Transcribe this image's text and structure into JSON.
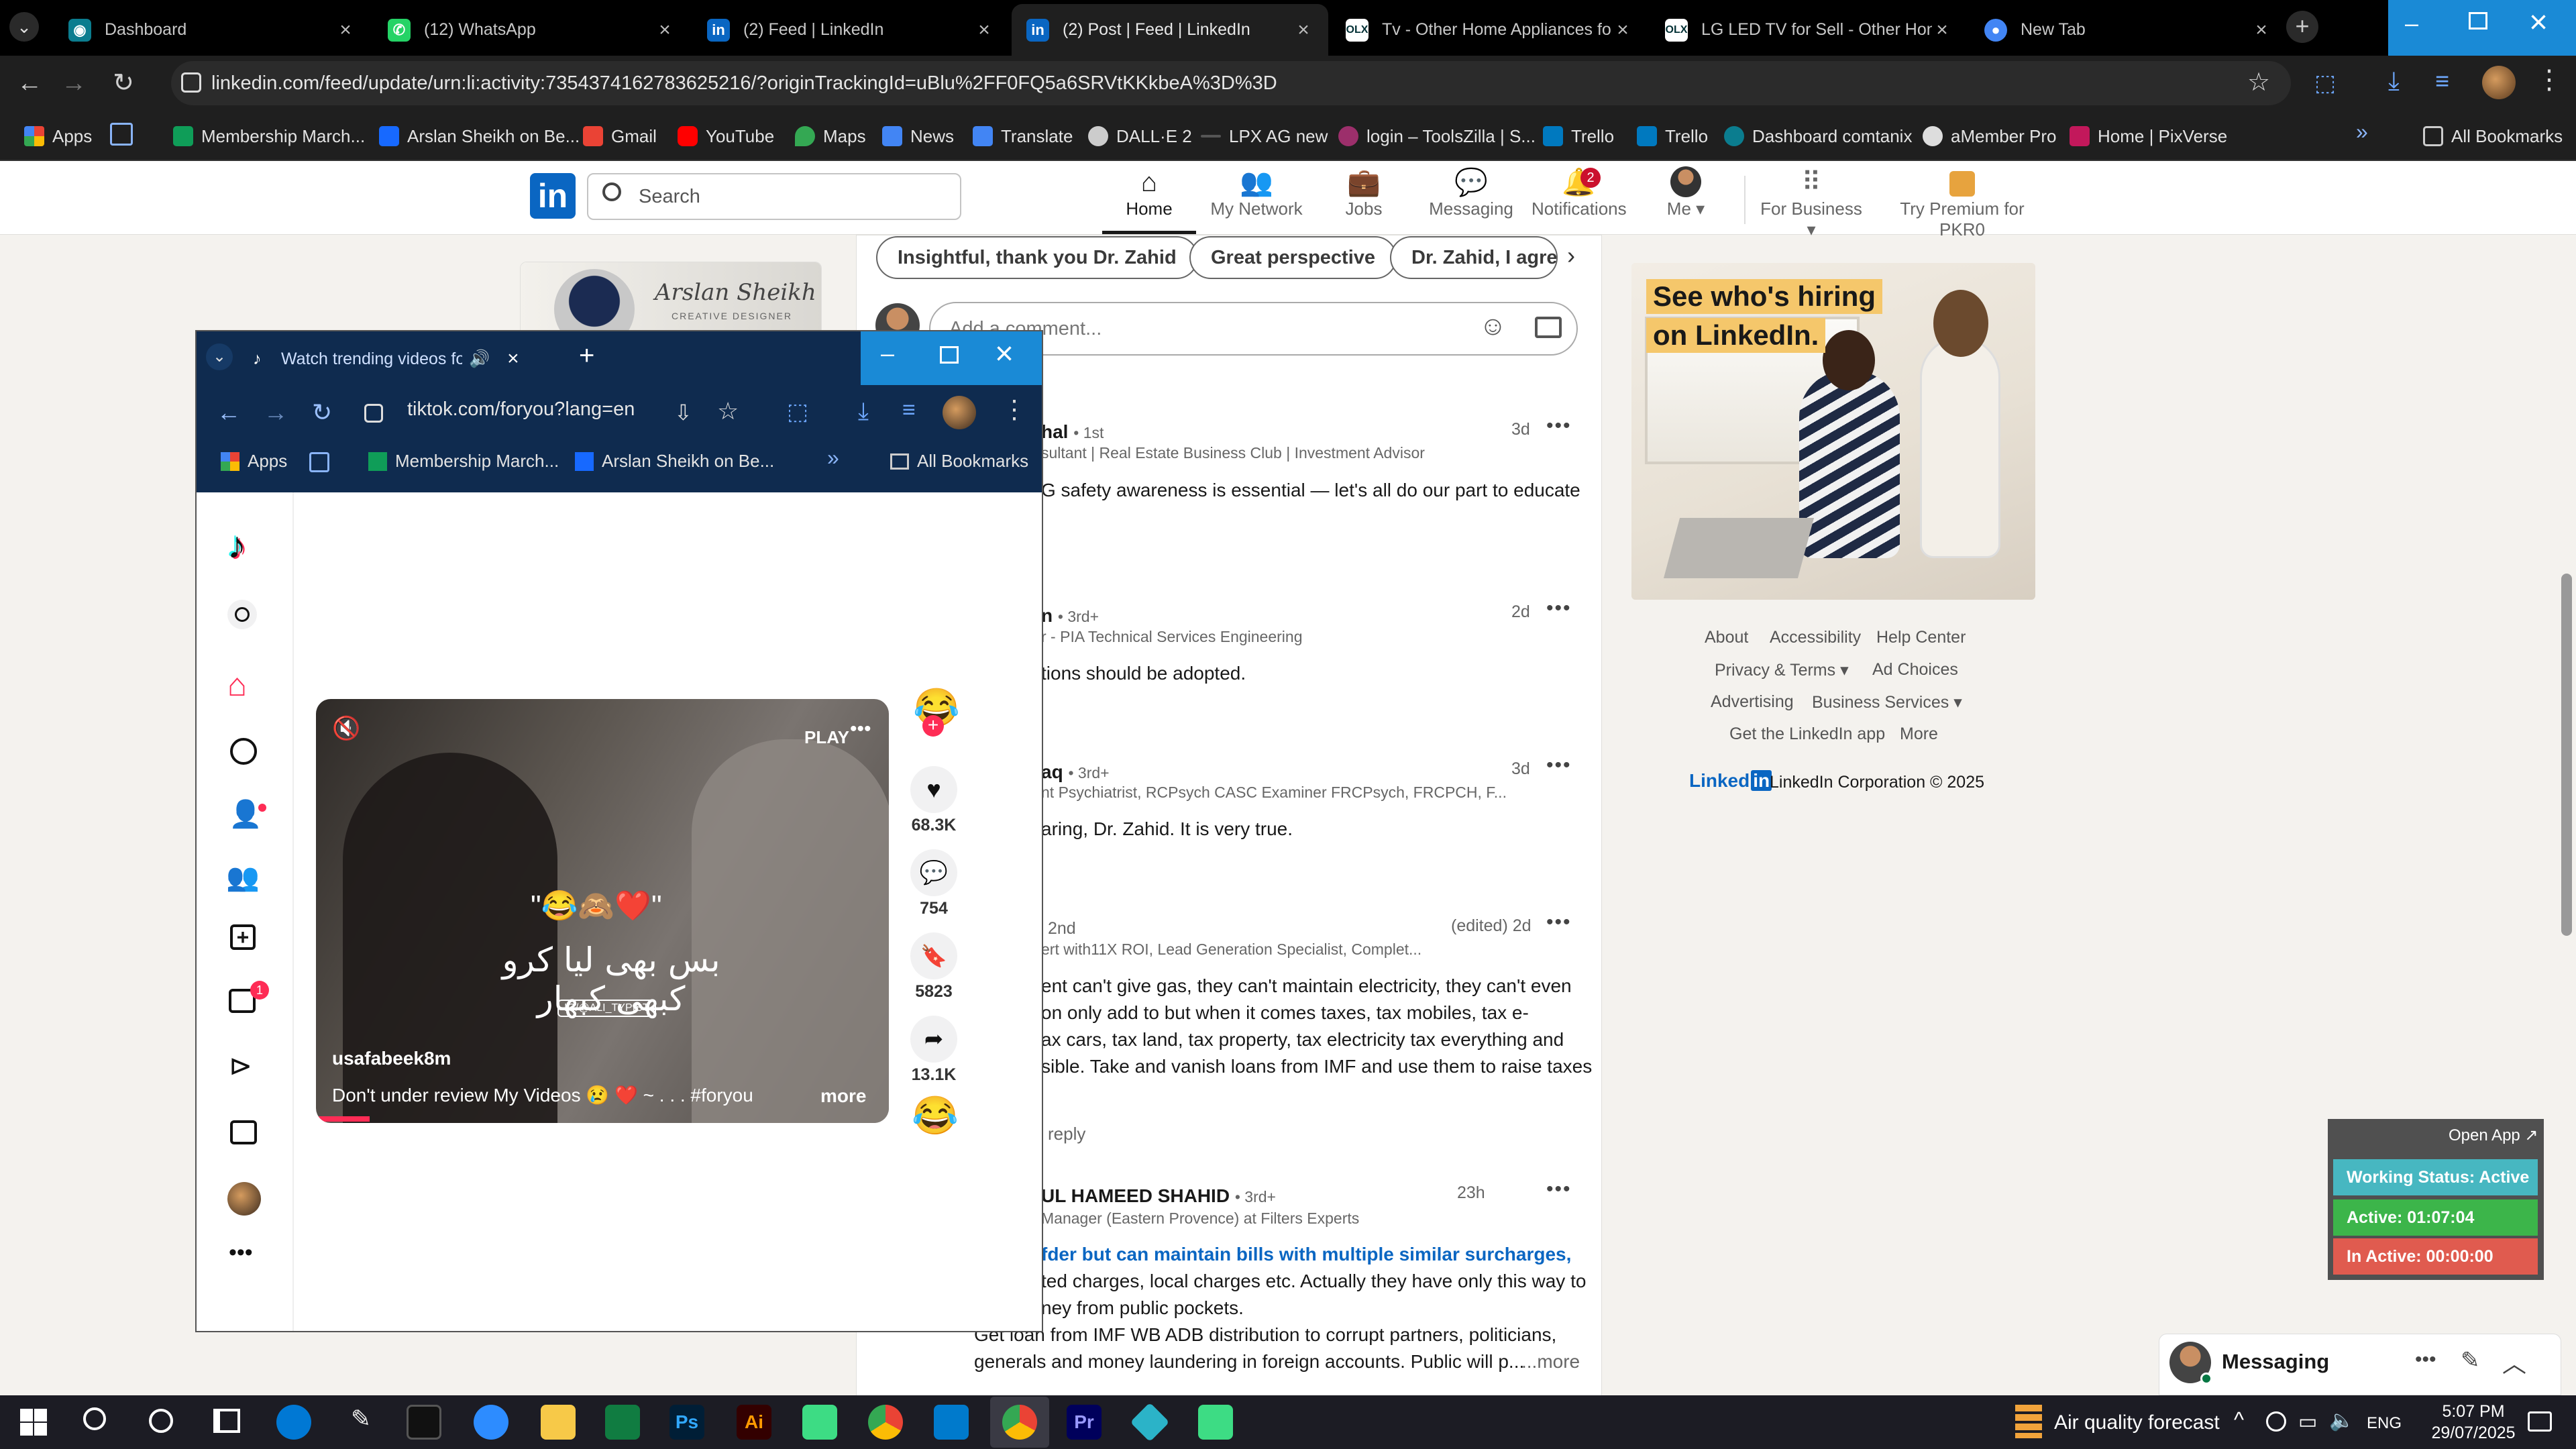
{
  "browser": {
    "tabs": [
      {
        "label": "Dashboard",
        "icon": "dashboard-icon",
        "color": "#0b7d8f"
      },
      {
        "label": "(12) WhatsApp",
        "icon": "whatsapp-icon",
        "color": "#25d366"
      },
      {
        "label": "(2) Feed | LinkedIn",
        "icon": "linkedin-icon",
        "color": "#0a66c2"
      },
      {
        "label": "(2) Post | Feed | LinkedIn",
        "icon": "linkedin-icon",
        "color": "#0a66c2"
      },
      {
        "label": "Tv - Other Home Appliances fo",
        "icon": "olx-icon",
        "color": "#ffffff"
      },
      {
        "label": "LG LED TV for Sell - Other Hon",
        "icon": "olx-icon",
        "color": "#ffffff"
      },
      {
        "label": "New Tab",
        "icon": "chrome-icon",
        "color": "#4285f4"
      }
    ],
    "url": "linkedin.com/feed/update/urn:li:activity:7354374162783625216/?originTrackingId=uBlu%2FF0FQ5a6SRVtKKkbeA%3D%3D",
    "bookmarks": [
      "Apps",
      "Membership March...",
      "Arslan Sheikh on Be...",
      "Gmail",
      "YouTube",
      "Maps",
      "News",
      "Translate",
      "DALL·E 2",
      "LPX AG new",
      "login – ToolsZilla | S...",
      "Trello",
      "Trello",
      "Dashboard comtanix",
      "aMember Pro",
      "Home | PixVerse"
    ],
    "all_bookmarks": "All Bookmarks"
  },
  "linkedin": {
    "search_placeholder": "Search",
    "nav": [
      {
        "label": "Home",
        "icon": "home-icon"
      },
      {
        "label": "My Network",
        "icon": "network-icon"
      },
      {
        "label": "Jobs",
        "icon": "jobs-icon"
      },
      {
        "label": "Messaging",
        "icon": "messaging-icon"
      },
      {
        "label": "Notifications",
        "icon": "bell-icon",
        "badge": "2"
      },
      {
        "label": "Me",
        "icon": "avatar"
      },
      {
        "label": "For Business",
        "icon": "grid-icon"
      },
      {
        "label": "Try Premium for PKR0",
        "icon": "premium-icon"
      }
    ],
    "profile_card": {
      "name": "Arslan Sheikh",
      "subtitle": "CREATIVE DESIGNER"
    },
    "chips": [
      "Insightful, thank you Dr. Zahid",
      "Great perspective",
      "Dr. Zahid, I agree"
    ],
    "comment_placeholder": "Add a comment...",
    "comments": [
      {
        "name": "hal",
        "degree": "• 1st",
        "headline": "sultant | Real Estate Business Club | Investment Advisor",
        "time": "3d",
        "text": [
          "G safety awareness is essential — let's all do our part to educate"
        ]
      },
      {
        "name": "n",
        "degree": "• 3rd+",
        "headline": "r - PIA Technical Services Engineering",
        "time": "2d",
        "text": [
          "tions should be adopted."
        ]
      },
      {
        "name": "aq",
        "degree": "• 3rd+",
        "headline": "nt Psychiatrist, RCPsych CASC Examiner FRCPsych, FRCPCH, F...",
        "time": "3d",
        "text": [
          "aring, Dr. Zahid. It is very true."
        ]
      },
      {
        "name": "",
        "degree": "2nd",
        "headline": "ert with11X ROI, Lead Generation Specialist, Complet...",
        "time": "(edited) 2d",
        "text": [
          "ent can't give gas, they can't maintain electricity, they can't even",
          "on only add to but when it comes taxes, tax mobiles, tax e-",
          "ax cars, tax land, tax property, tax electricity tax everything and",
          "sible. Take and vanish loans from IMF and use them to raise taxes"
        ],
        "reply": "reply"
      },
      {
        "name": "UL HAMEED SHAHID",
        "degree": "• 3rd+",
        "headline": "Manager (Eastern Provence) at Filters Experts",
        "time": "23h",
        "text": [
          "fder but can maintain bills with multiple similar surcharges,",
          "ted charges, local charges etc. Actually they have only this way to",
          "ney from public pockets.",
          "Get loan from IMF WB ADB distribution to corrupt partners, politicians,",
          "generals and money laundering in foreign accounts. Public will p..."
        ],
        "more": "...more"
      }
    ],
    "ad": {
      "line1": "See who's hiring",
      "line2": "on LinkedIn."
    },
    "footer": {
      "about": "About",
      "accessibility": "Accessibility",
      "help": "Help Center",
      "privacy": "Privacy & Terms",
      "ad_choices": "Ad Choices",
      "advertising": "Advertising",
      "business": "Business Services",
      "getapp": "Get the LinkedIn app",
      "more": "More",
      "brand": "Linked",
      "copyright": "LinkedIn Corporation © 2025"
    },
    "messaging": "Messaging"
  },
  "tiktok_window": {
    "tab_title": "Watch trending videos for y",
    "url": "tiktok.com/foryou?lang=en",
    "bookmarks": [
      "Apps",
      "Membership March...",
      "Arslan Sheikh on Be..."
    ],
    "all_bookmarks": "All Bookmarks",
    "video": {
      "username": "usafabeek8m",
      "caption": "Don't under review My Videos 😢 ❤️ ~ . . . #foryou",
      "more": "more",
      "play_label": "PLAY",
      "overlay_urdu": "بس بھی لیا کرو کبھی کبھار",
      "overlay_emoji": "\"😂🙈❤️\"",
      "watermark": "IG/@ALI_TYPIST"
    },
    "stats": {
      "likes": "68.3K",
      "comments": "754",
      "saves": "5823",
      "shares": "13.1K"
    },
    "sidebar_badge": "1"
  },
  "widget": {
    "open_app": "Open App ↗",
    "working": "Working Status: Active",
    "active": "Active: 01:07:04",
    "inactive": "In Active: 00:00:00",
    "colors": {
      "working": "#47b7c1",
      "active": "#3cb54a",
      "inactive": "#e05b4f"
    }
  },
  "taskbar": {
    "weather": "Air quality forecast",
    "lang": "ENG",
    "time": "5:07 PM",
    "date": "29/07/2025"
  }
}
